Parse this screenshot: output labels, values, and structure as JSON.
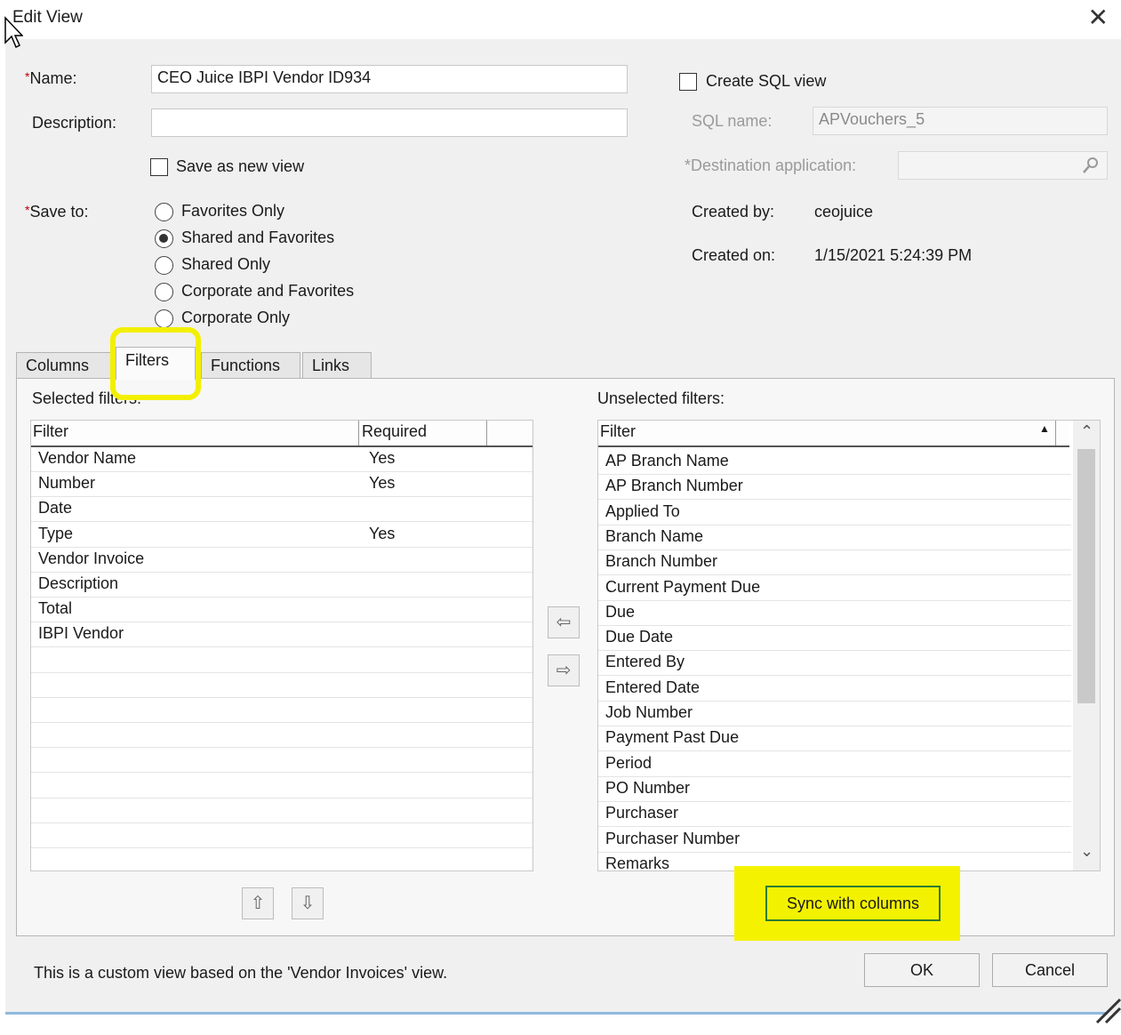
{
  "window": {
    "title": "Edit View",
    "close_glyph": "✕"
  },
  "form": {
    "name_label": "Name:",
    "name_value": "CEO Juice IBPI Vendor ID934",
    "description_label": "Description:",
    "description_value": "",
    "save_as_new_label": "Save as new view",
    "save_to_label": "Save to:",
    "required_mark": "*",
    "save_to_options": [
      {
        "label": "Favorites Only",
        "selected": false
      },
      {
        "label": "Shared and Favorites",
        "selected": true
      },
      {
        "label": "Shared Only",
        "selected": false
      },
      {
        "label": "Corporate and Favorites",
        "selected": false
      },
      {
        "label": "Corporate Only",
        "selected": false
      }
    ]
  },
  "sql": {
    "create_sql_label": "Create SQL view",
    "sql_name_label": "SQL name:",
    "sql_name_value": "APVouchers_5",
    "dest_app_label": "*Destination application:",
    "dest_app_value": "",
    "created_by_label": "Created by:",
    "created_by_value": "ceojuice",
    "created_on_label": "Created on:",
    "created_on_value": "1/15/2021 5:24:39 PM"
  },
  "tabs": [
    {
      "label": "Columns",
      "active": false
    },
    {
      "label": "Filters",
      "active": true
    },
    {
      "label": "Functions",
      "active": false
    },
    {
      "label": "Links",
      "active": false
    }
  ],
  "selected_filters": {
    "title": "Selected filters:",
    "columns": [
      "Filter",
      "Required"
    ],
    "rows": [
      {
        "filter": "Vendor Name",
        "required": "Yes"
      },
      {
        "filter": "Number",
        "required": "Yes"
      },
      {
        "filter": "Date",
        "required": ""
      },
      {
        "filter": "Type",
        "required": "Yes"
      },
      {
        "filter": "Vendor Invoice",
        "required": ""
      },
      {
        "filter": "Description",
        "required": ""
      },
      {
        "filter": "Total",
        "required": ""
      },
      {
        "filter": "IBPI Vendor",
        "required": ""
      }
    ]
  },
  "unselected_filters": {
    "title": "Unselected filters:",
    "column": "Filter",
    "sort_glyph": "▲",
    "rows": [
      "AP Branch Name",
      "AP Branch Number",
      "Applied To",
      "Branch Name",
      "Branch Number",
      "Current Payment Due",
      "Due",
      "Due Date",
      "Entered By",
      "Entered Date",
      "Job Number",
      "Payment Past Due",
      "Period",
      "PO Number",
      "Purchaser",
      "Purchaser Number",
      "Remarks"
    ]
  },
  "buttons": {
    "move_left": "⇦",
    "move_right": "⇨",
    "move_up": "⇧",
    "move_down": "⇩",
    "sync": "Sync with columns",
    "ok": "OK",
    "cancel": "Cancel",
    "scroll_up": "⌃",
    "scroll_down": "⌄"
  },
  "footer": {
    "text": "This is a custom view based on the 'Vendor Invoices' view."
  },
  "colors": {
    "highlight": "#f3ef00",
    "sync_border": "#2e7d32",
    "required_mark": "#c00000"
  }
}
